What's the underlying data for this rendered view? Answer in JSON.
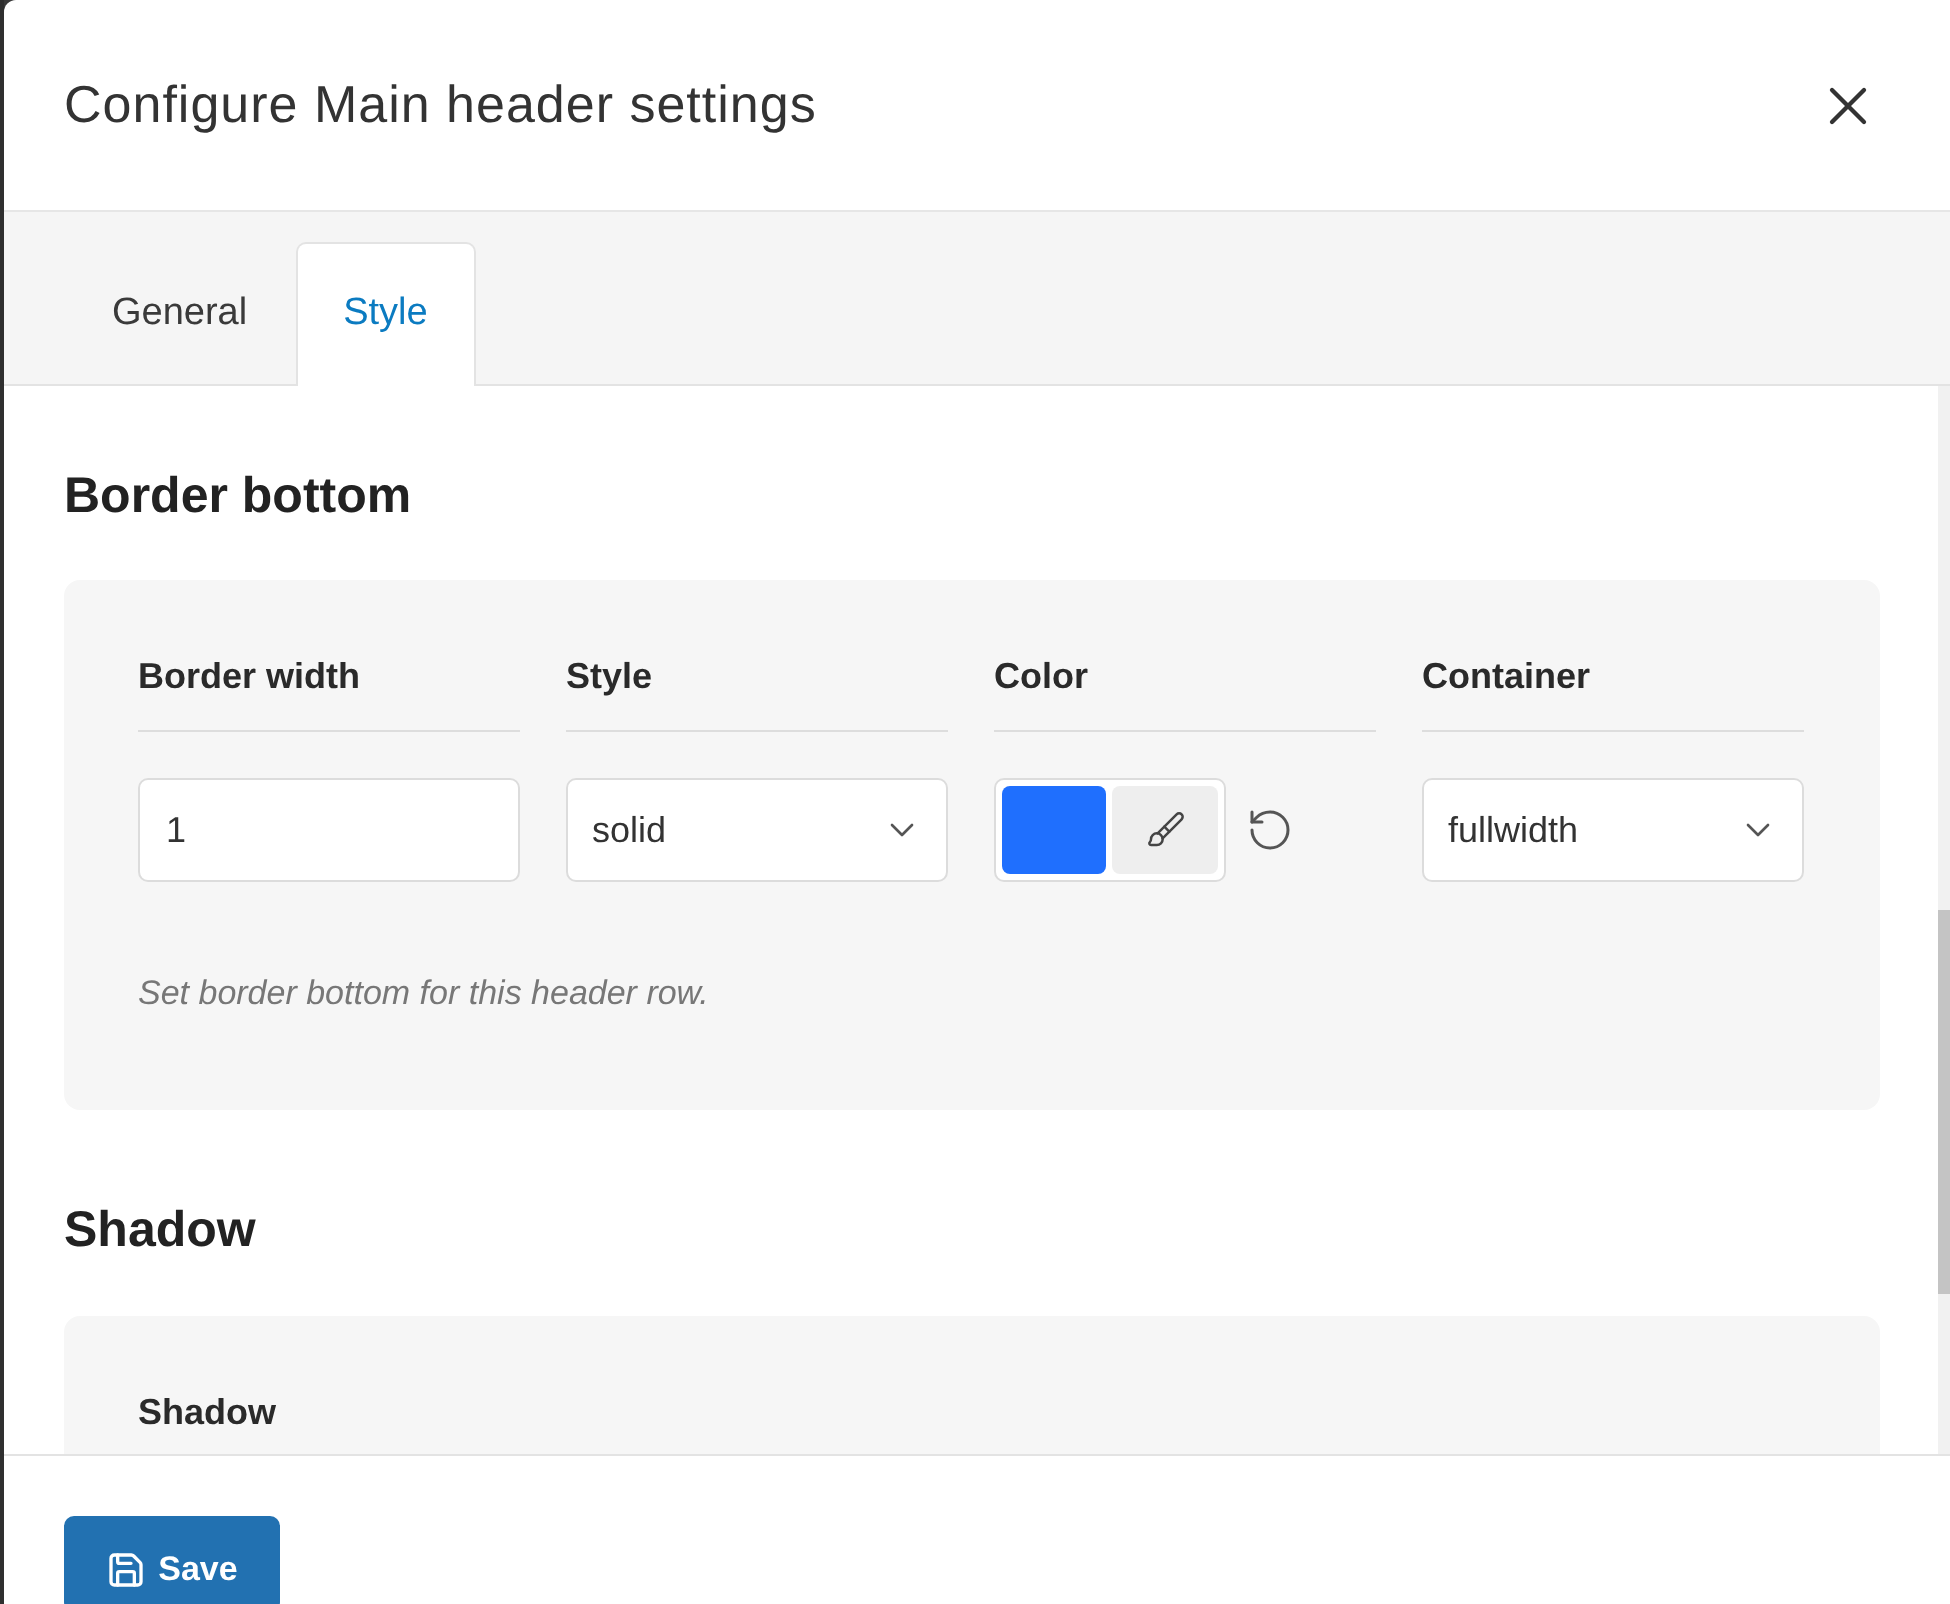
{
  "dialog": {
    "title": "Configure Main header settings"
  },
  "tabs": [
    {
      "label": "General",
      "selected": false
    },
    {
      "label": "Style",
      "selected": true
    }
  ],
  "sections": [
    {
      "heading": "Border bottom",
      "fields": [
        {
          "kind": "number",
          "label": "Border width",
          "value": "1"
        },
        {
          "kind": "select",
          "label": "Style",
          "value": "solid"
        },
        {
          "kind": "color",
          "label": "Color",
          "color": "#1f6ffe"
        },
        {
          "kind": "select",
          "label": "Container",
          "value": "fullwidth"
        }
      ],
      "help": "Set border bottom for this header row."
    },
    {
      "heading": "Shadow",
      "fields": [
        {
          "label": "Shadow"
        }
      ]
    }
  ],
  "footer": {
    "save_button": "Save"
  }
}
